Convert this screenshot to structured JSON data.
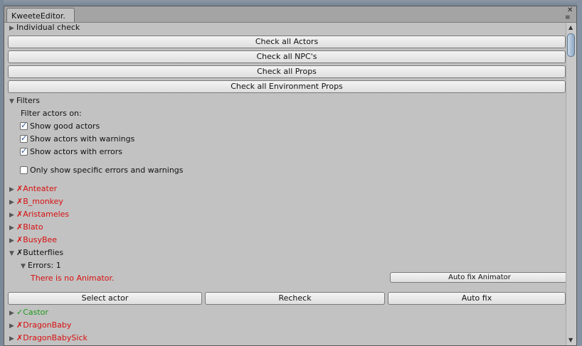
{
  "window": {
    "tab_title": "KweeteEditor.",
    "close_glyph": "✕",
    "menu_glyph": "≡"
  },
  "individual_check": {
    "label": "Individual check"
  },
  "check_buttons": [
    "Check all Actors",
    "Check all NPC's",
    "Check all Props",
    "Check all Environment Props"
  ],
  "filters": {
    "label": "Filters",
    "heading": "Filter actors on:",
    "options": [
      {
        "label": "Show good actors",
        "checked": true
      },
      {
        "label": "Show actors with warnings",
        "checked": true
      },
      {
        "label": "Show actors with errors",
        "checked": true
      }
    ],
    "specific": {
      "label": "Only show specific errors and warnings",
      "checked": false
    }
  },
  "actors_before": [
    {
      "name": "Anteater",
      "status": "error",
      "mark": "✗"
    },
    {
      "name": "B_monkey",
      "status": "error",
      "mark": "✗"
    },
    {
      "name": "Aristameles",
      "status": "error",
      "mark": "✗"
    },
    {
      "name": "Blato",
      "status": "error",
      "mark": "✗"
    },
    {
      "name": "BusyBee",
      "status": "error",
      "mark": "✗"
    }
  ],
  "expanded_actor": {
    "name": "Butterflies",
    "mark": "✗",
    "errors_label": "Errors: 1",
    "error_message": "There is no Animator.",
    "fix_button": "Auto fix Animator",
    "actions": [
      "Select actor",
      "Recheck",
      "Auto fix"
    ]
  },
  "actors_after": [
    {
      "name": "Castor",
      "status": "good",
      "mark": "✓"
    },
    {
      "name": "DragonBaby",
      "status": "error",
      "mark": "✗"
    },
    {
      "name": "DragonBabySick",
      "status": "error",
      "mark": "✗"
    }
  ],
  "colors": {
    "error": "#d80f0f",
    "good": "#1f9a1f",
    "panel": "#c2c2c2"
  }
}
